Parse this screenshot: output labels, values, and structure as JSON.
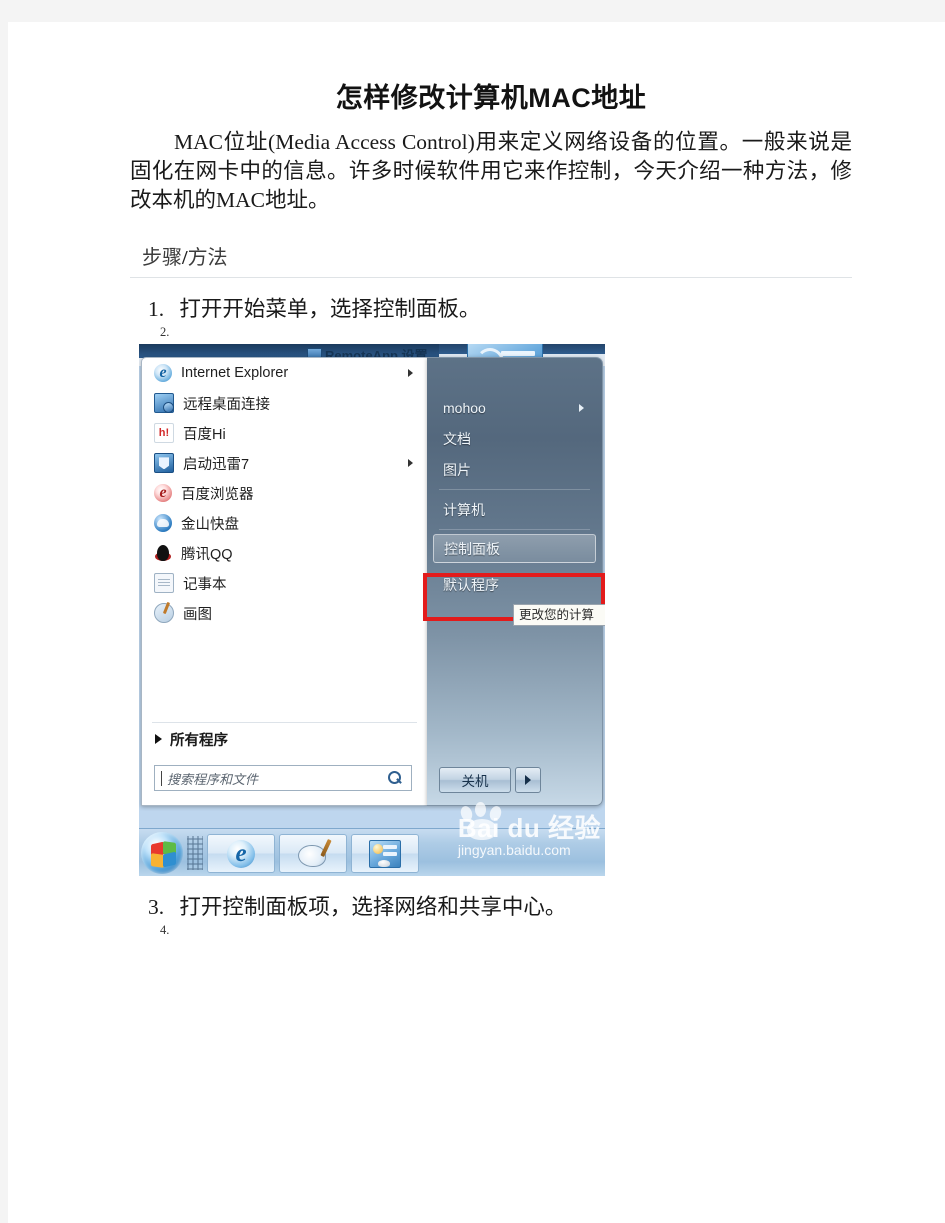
{
  "document": {
    "title": "怎样修改计算机MAC地址",
    "intro": {
      "lead_latin": "MAC位址(Media   Access   Control)",
      "full": "MAC位址(Media   Access   Control)用来定义网络设备的位置。一般来说是固化在网卡中的信息。许多时候软件用它来作控制，今天介绍一种方法，修改本机的MAC地址。"
    },
    "section_heading": {
      "part1": "步骤",
      "separator": "/",
      "part2": "方法"
    },
    "steps": [
      {
        "num": "1.",
        "text": "打开开始菜单，选择控制面板。"
      },
      {
        "num": "2.",
        "text": ""
      },
      {
        "num": "3.",
        "text": "打开控制面板项，选择网络和共享中心。"
      },
      {
        "num": "4.",
        "text": ""
      }
    ]
  },
  "screenshot": {
    "background_window": {
      "title": "RemoteApp 设置"
    },
    "start_menu": {
      "programs": [
        {
          "label": "Internet Explorer",
          "icon": "internet-explorer-icon",
          "has_submenu": true
        },
        {
          "label": "远程桌面连接",
          "icon": "remote-desktop-icon",
          "has_submenu": false
        },
        {
          "label": "百度Hi",
          "icon": "baidu-hi-icon",
          "has_submenu": false
        },
        {
          "label": "启动迅雷7",
          "icon": "thunder-icon",
          "has_submenu": true
        },
        {
          "label": "百度浏览器",
          "icon": "baidu-browser-icon",
          "has_submenu": false
        },
        {
          "label": "金山快盘",
          "icon": "kingsoft-kuaipan-icon",
          "has_submenu": false
        },
        {
          "label": "腾讯QQ",
          "icon": "tencent-qq-icon",
          "has_submenu": false
        },
        {
          "label": "记事本",
          "icon": "notepad-icon",
          "has_submenu": false
        },
        {
          "label": "画图",
          "icon": "paint-icon",
          "has_submenu": false
        }
      ],
      "all_programs_label": "所有程序",
      "search": {
        "placeholder": "搜索程序和文件",
        "value": ""
      },
      "right_items": [
        {
          "label": "mohoo",
          "has_submenu": true,
          "selected": false
        },
        {
          "label": "文档",
          "has_submenu": false,
          "selected": false
        },
        {
          "label": "图片",
          "has_submenu": false,
          "selected": false
        },
        {
          "label": "计算机",
          "has_submenu": false,
          "selected": false
        },
        {
          "label": "控制面板",
          "has_submenu": false,
          "selected": true
        },
        {
          "label": "默认程序",
          "has_submenu": false,
          "selected": false
        }
      ],
      "tooltip_text": "更改您的计算",
      "shutdown_label": "关机",
      "highlight_color": "#e31b1b"
    },
    "taskbar": {
      "start_orb": "windows-start-orb-icon",
      "buttons": [
        {
          "icon": "internet-explorer-icon"
        },
        {
          "icon": "paint-icon"
        },
        {
          "icon": "control-panel-icon"
        }
      ]
    },
    "watermark": {
      "main": "Bai du 经验",
      "sub": "jingyan.baidu.com"
    }
  }
}
